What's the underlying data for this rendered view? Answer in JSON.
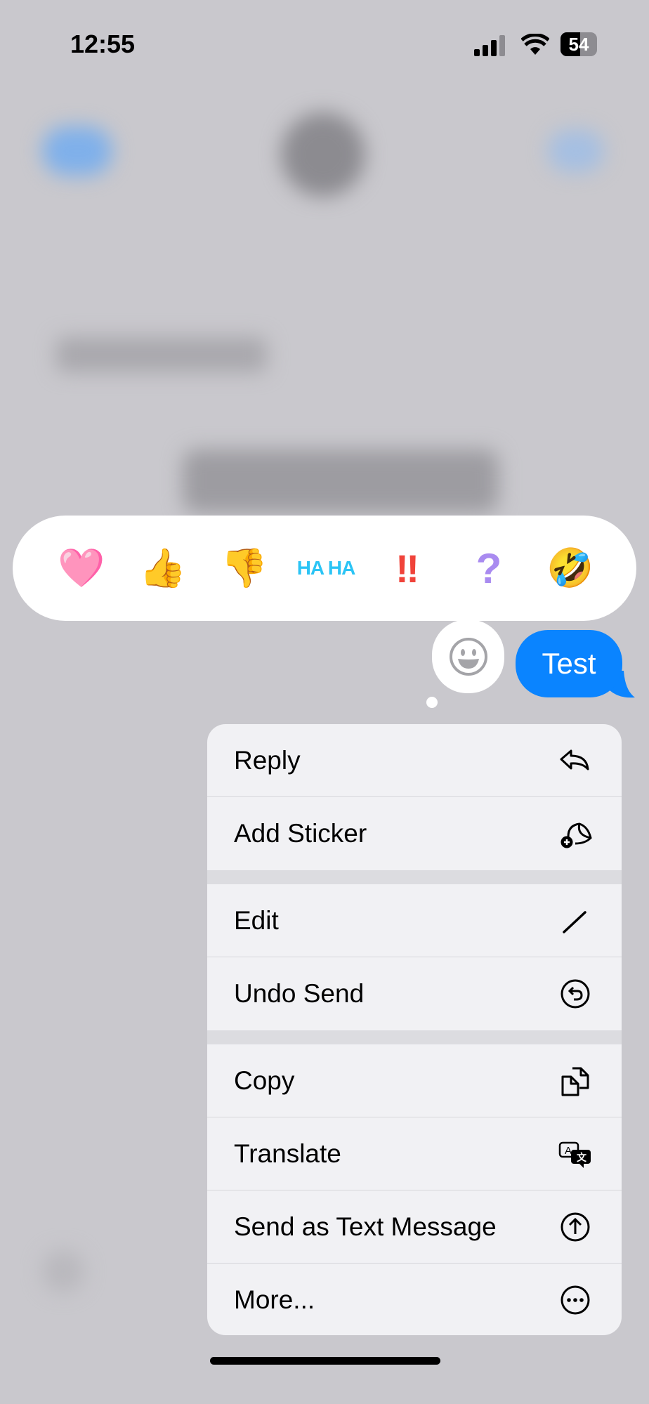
{
  "status_bar": {
    "time": "12:55",
    "battery": "54",
    "signal_bars": 3,
    "wifi": "wifi-icon"
  },
  "reactions": [
    {
      "name": "heart",
      "glyph": "🩷"
    },
    {
      "name": "thumbs-up",
      "glyph": "👍"
    },
    {
      "name": "thumbs-down",
      "glyph": "👎"
    },
    {
      "name": "haha",
      "glyph": "HA HA"
    },
    {
      "name": "exclamation",
      "glyph": "‼"
    },
    {
      "name": "question",
      "glyph": "?"
    },
    {
      "name": "rofl",
      "glyph": "🤣"
    },
    {
      "name": "more-heart",
      "glyph": "❤"
    }
  ],
  "message": {
    "text": "Test",
    "color": "#0a84ff"
  },
  "menu": {
    "items": [
      {
        "label": "Reply",
        "icon": "reply-icon"
      },
      {
        "label": "Add Sticker",
        "icon": "sticker-icon"
      },
      {
        "label": "Edit",
        "icon": "pencil-icon"
      },
      {
        "label": "Undo Send",
        "icon": "undo-icon"
      },
      {
        "label": "Copy",
        "icon": "copy-icon"
      },
      {
        "label": "Translate",
        "icon": "translate-icon"
      },
      {
        "label": "Send as Text Message",
        "icon": "arrow-up-circle-icon"
      },
      {
        "label": "More...",
        "icon": "ellipsis-circle-icon"
      }
    ]
  }
}
